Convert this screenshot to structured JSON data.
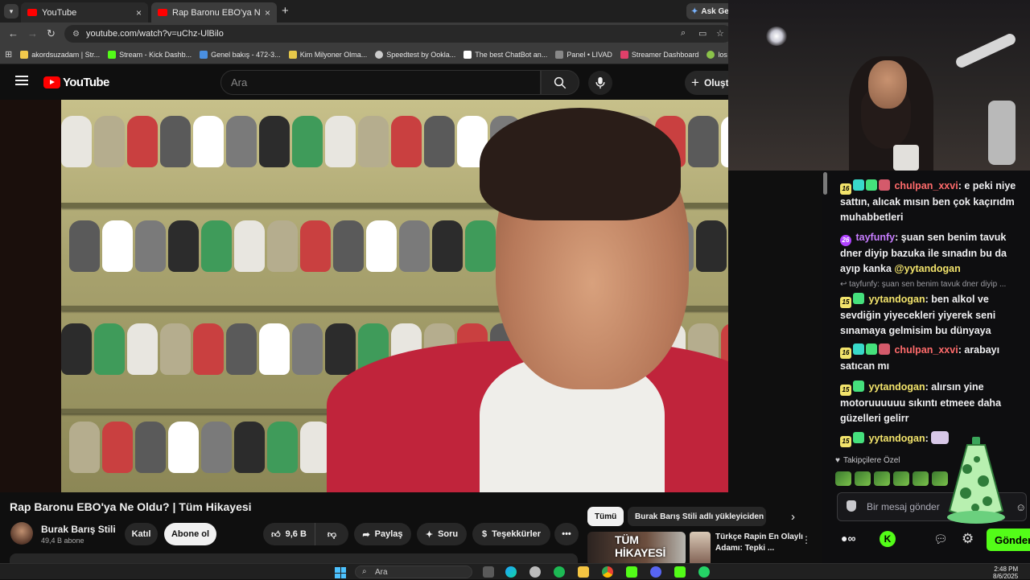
{
  "browser": {
    "tabs": [
      {
        "title": "YouTube"
      },
      {
        "title": "Rap Baronu EBO'ya Ne Oldu? |"
      }
    ],
    "ask_gemini": "Ask Gem",
    "url": "youtube.com/watch?v=uChz-UlBilo",
    "bookmarks": [
      {
        "label": "akordsuzadam | Str...",
        "color": "#f2c94c"
      },
      {
        "label": "Stream - Kick Dashb...",
        "color": "#53fc18"
      },
      {
        "label": "Genel bakış - 472-3...",
        "color": "#4a90e2"
      },
      {
        "label": "Kim Milyoner Olma...",
        "color": "#e6c84a"
      },
      {
        "label": "Speedtest by Ookla...",
        "color": "#cccccc"
      },
      {
        "label": "The best ChatBot an...",
        "color": "#ffffff"
      },
      {
        "label": "Panel • LIVAD",
        "color": "#888888"
      },
      {
        "label": "Streamer Dashboard",
        "color": "#e0406a"
      },
      {
        "label": "los angeles - #",
        "color": "#8bc34a"
      }
    ]
  },
  "youtube": {
    "logo_text": "YouTube",
    "search_placeholder": "Ara",
    "create_label": "Oluşt",
    "video_title": "Rap Baronu EBO'ya Ne Oldu? | Tüm Hikayesi",
    "channel_name": "Burak Barış Stili",
    "channel_subs": "49,4 B abone",
    "join_label": "Katıl",
    "subscribe_label": "Abone ol",
    "like_count": "9,6 B",
    "share_label": "Paylaş",
    "ask_label": "Soru",
    "thanks_label": "Teşekkürler",
    "chips": {
      "all": "Tümü",
      "uploader": "Burak Barış Stili adlı yükleyiciden"
    },
    "recommendation": {
      "thumb_text": "TÜM HİKAYESİ",
      "title": "Türkçe Rapin En Olaylı Adamı: Tepki ..."
    }
  },
  "chat": {
    "messages": [
      {
        "badge": "16",
        "user": "chulpan_xxvi",
        "user_color": "#ff6b6b",
        "text": "e peki niye sattın, alıcak mısın ben çok kaçırıdm muhabbetleri"
      },
      {
        "badge": "26",
        "user": "tayfunfy",
        "user_color": "#c77dff",
        "text": "şuan sen benim tavuk dner diyip bazuka ile sınadın bu da ayıp kanka",
        "mention": "@yytandogan"
      },
      {
        "reply_context": "tayfunfy: şuan sen benim tavuk dner diyip ..."
      },
      {
        "badge": "15",
        "user": "yytandogan",
        "user_color": "#f2e36b",
        "text": "ben alkol ve sevdiğin yiyecekleri yiyerek seni sınamaya gelmisim bu dünyaya"
      },
      {
        "badge": "16",
        "user": "chulpan_xxvi",
        "user_color": "#ff6b6b",
        "text": "arabayı satıcan mı"
      },
      {
        "badge": "15",
        "user": "yytandogan",
        "user_color": "#f2e36b",
        "text": "alırsın yine motoruuuuuu sıkıntı etmeee daha güzelleri gelirr"
      },
      {
        "badge": "15",
        "user": "yytandogan",
        "user_color": "#f2e36b",
        "text": ""
      }
    ],
    "followers_only": "Takipçilere Özel",
    "input_placeholder": "Bir mesaj gönder",
    "send_label": "Gönder"
  },
  "taskbar": {
    "search_placeholder": "Ara",
    "time": "2:48 PM",
    "date": "8/6/2025"
  }
}
